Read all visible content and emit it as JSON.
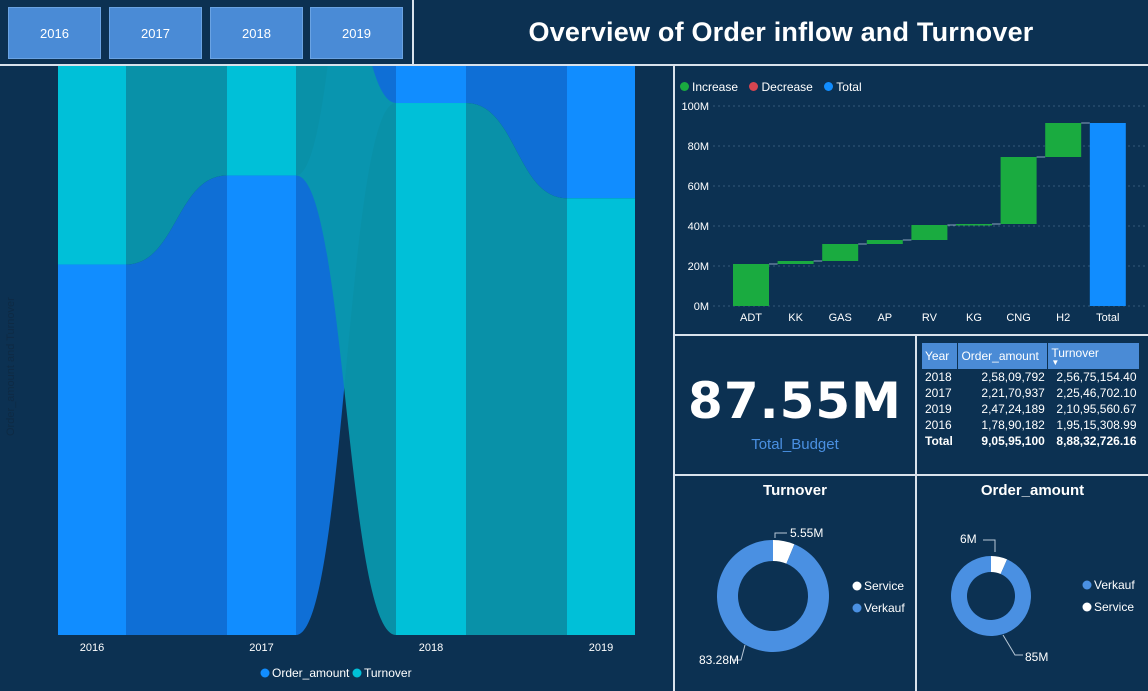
{
  "year_buttons": [
    "2016",
    "2017",
    "2018",
    "2019"
  ],
  "title": "Overview of Order inflow and Turnover",
  "ribbon": {
    "ylabel": "Order_amount and Turnover",
    "legend": [
      {
        "name": "Order_amount",
        "color": "#118dff"
      },
      {
        "name": "Turnover",
        "color": "#00c0d8"
      }
    ]
  },
  "waterfall_legend": [
    {
      "name": "Increase",
      "color": "#1aab40"
    },
    {
      "name": "Decrease",
      "color": "#d64550"
    },
    {
      "name": "Total",
      "color": "#118dff"
    }
  ],
  "card": {
    "value": "87.55M",
    "label": "Total_Budget"
  },
  "table": {
    "headers": [
      "Year",
      "Order_amount",
      "Turnover"
    ],
    "rows": [
      [
        "2018",
        "2,58,09,792",
        "2,56,75,154.40"
      ],
      [
        "2017",
        "2,21,70,937",
        "2,25,46,702.10"
      ],
      [
        "2019",
        "2,47,24,189",
        "2,10,95,560.67"
      ],
      [
        "2016",
        "1,78,90,182",
        "1,95,15,308.99"
      ]
    ],
    "total": [
      "Total",
      "9,05,95,100",
      "8,88,32,726.16"
    ]
  },
  "donut_turnover": {
    "title": "Turnover",
    "legend": [
      {
        "name": "Service",
        "color": "#ffffff"
      },
      {
        "name": "Verkauf",
        "color": "#4a90e2"
      }
    ],
    "labels": {
      "service": "5.55M",
      "verkauf": "83.28M"
    }
  },
  "donut_order": {
    "title": "Order_amount",
    "legend": [
      {
        "name": "Verkauf",
        "color": "#4a90e2"
      },
      {
        "name": "Service",
        "color": "#ffffff"
      }
    ],
    "labels": {
      "service": "6M",
      "verkauf": "85M"
    }
  },
  "chart_data": [
    {
      "type": "area",
      "subtype": "ribbon",
      "title": "",
      "xlabel": "",
      "ylabel": "Order_amount and Turnover",
      "categories": [
        "2016",
        "2017",
        "2018",
        "2019"
      ],
      "series": [
        {
          "name": "Order_amount",
          "values": [
            17.9,
            22.2,
            25.8,
            24.7
          ]
        },
        {
          "name": "Turnover",
          "values": [
            19.5,
            22.5,
            25.7,
            21.1
          ]
        }
      ],
      "units": "M",
      "legend": "bottom"
    },
    {
      "type": "bar",
      "subtype": "waterfall",
      "categories": [
        "ADT",
        "KK",
        "GAS",
        "AP",
        "RV",
        "KG",
        "CNG",
        "H2",
        "Total"
      ],
      "values": [
        21,
        1.5,
        8.5,
        2,
        7.5,
        0.5,
        33.5,
        17,
        91.5
      ],
      "kinds": [
        "increase",
        "increase",
        "increase",
        "increase",
        "increase",
        "increase",
        "increase",
        "increase",
        "total"
      ],
      "yticks": [
        "0M",
        "20M",
        "40M",
        "60M",
        "80M",
        "100M"
      ],
      "ylim": [
        0,
        100
      ],
      "grid": true,
      "legend": "top-left"
    },
    {
      "type": "pie",
      "subtype": "donut",
      "title": "Turnover",
      "categories": [
        "Service",
        "Verkauf"
      ],
      "values": [
        5.55,
        83.28
      ]
    },
    {
      "type": "pie",
      "subtype": "donut",
      "title": "Order_amount",
      "categories": [
        "Service",
        "Verkauf"
      ],
      "values": [
        6,
        85
      ]
    }
  ]
}
